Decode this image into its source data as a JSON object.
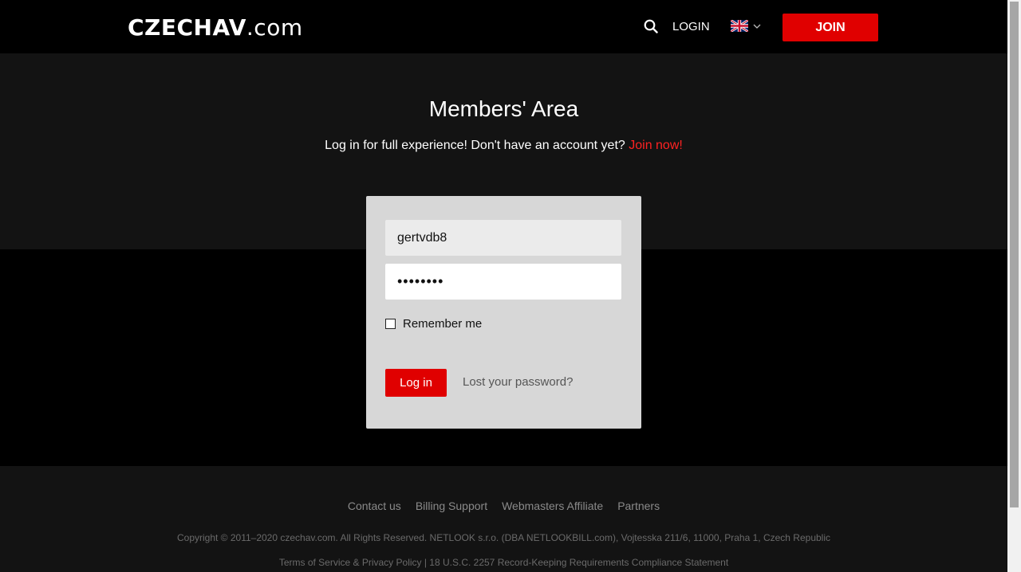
{
  "header": {
    "logo_bold": "CZECHAV",
    "logo_suffix": ".com",
    "login_label": "LOGIN",
    "join_label": "JOIN",
    "language_icon": "uk-flag-icon"
  },
  "hero": {
    "title": "Members' Area",
    "subtitle": "Log in for full experience! Don't have an account yet?",
    "join_now": "Join now!"
  },
  "login_form": {
    "username_value": "gertvdb8",
    "password_value": "••••••••",
    "remember_label": "Remember me",
    "login_button": "Log in",
    "lost_password": "Lost your password?"
  },
  "footer": {
    "links": [
      "Contact us",
      "Billing Support",
      "Webmasters Affiliate",
      "Partners"
    ],
    "copyright": "Copyright © 2011–2020 czechav.com. All Rights Reserved. NETLOOK s.r.o. (DBA NETLOOKBILL.com), Vojtesska 211/6, 11000, Praha 1, Czech Republic",
    "legal": "Terms of Service & Privacy Policy | 18 U.S.C. 2257 Record-Keeping Requirements Compliance Statement"
  },
  "colors": {
    "accent": "#e00000",
    "header_bg": "#000000",
    "section_bg": "#131313",
    "card_bg": "#d7d7d7"
  }
}
